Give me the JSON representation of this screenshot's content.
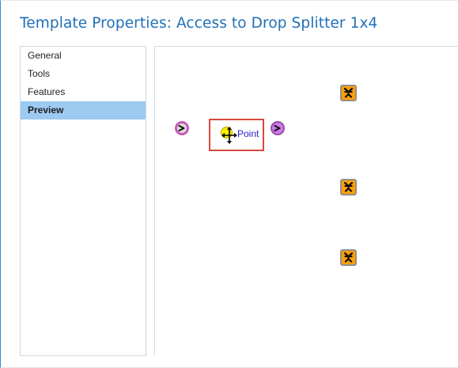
{
  "window": {
    "title": "Template Properties: Access to Drop Splitter 1x4"
  },
  "nav": {
    "items": [
      {
        "label": "General",
        "selected": false
      },
      {
        "label": "Tools",
        "selected": false
      },
      {
        "label": "Features",
        "selected": false
      },
      {
        "label": "Preview",
        "selected": true
      }
    ]
  },
  "preview": {
    "point_label": "Point",
    "icons": {
      "splice": "splice-closure-icon",
      "connector_in": "connector-arrow-icon",
      "connector_out": "connector-arrow-icon",
      "point": "point-icon",
      "cursor": "move-cursor-icon"
    },
    "colors": {
      "splice_fill": "#ff9f00",
      "connector_in_ring": "#c75ab8",
      "connector_out_fill": "#cf78e8",
      "point_fill": "#ffeb00",
      "selection_border": "#d9483b",
      "nav_selected": "#9dcaf0",
      "title_text": "#1f6fb7"
    }
  }
}
